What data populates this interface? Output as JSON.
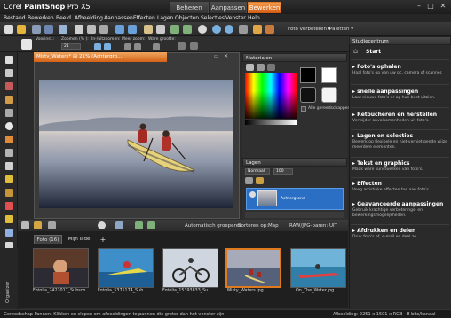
{
  "app": {
    "title_prefix": "Corel",
    "title_main": "PaintShop",
    "title_suffix": " Pro X5",
    "mode_tabs": [
      "Beheren",
      "Aanpassen",
      "Bewerken"
    ],
    "active_mode": "Bewerken",
    "window_buttons": [
      "–",
      "□",
      "✕"
    ]
  },
  "menu": [
    "Bestand",
    "Bewerken",
    "Beeld",
    "Afbeelding",
    "Aanpassen",
    "Effecten",
    "Lagen",
    "Objecten",
    "Selecties",
    "Venster",
    "Help"
  ],
  "toolbar": {
    "photo_fix": "Foto verbeteren ▾",
    "palettes": "Paletten ▾"
  },
  "options": {
    "labels": [
      "Voorinst.:",
      "Zoomen (% ):",
      "In-/uitzoomen:",
      "Meer zoom:",
      "Ware grootte:"
    ],
    "zoom_value": "21"
  },
  "image_window": {
    "tab_title": "Misty_Waters* @ 21% (Achtergro..."
  },
  "materials": {
    "title": "Materialen",
    "all_tools_label": "Alle gereedschappen"
  },
  "layers": {
    "title": "Lagen",
    "blend_mode": "Normaal",
    "opacity": "100",
    "layer_name": "Achtergrond"
  },
  "learning_center": {
    "title": "Studiecentrum",
    "start": "Start",
    "items": [
      {
        "title": "Foto's ophalen",
        "desc": "Haal foto's op van uw pc, camera of scanner."
      },
      {
        "title": "snelle aanpassingen",
        "desc": "Laat nieuwe foto's er op hun best uitzien."
      },
      {
        "title": "Retoucheren en herstellen",
        "desc": "Verwijder onvolkomenheden uit foto's."
      },
      {
        "title": "Lagen en selecties",
        "desc": "Bewerk op flexibele en niet-vernietigende wijze meerdere elementen."
      },
      {
        "title": "Tekst en graphics",
        "desc": "Maak ware kunstwerken van foto's."
      },
      {
        "title": "Effecten",
        "desc": "Voeg artistieke effecten toe aan foto's."
      },
      {
        "title": "Geavanceerde aanpassingen",
        "desc": "Gebruik krachtige verbeterings- en bewerkingsmogelijkheden."
      },
      {
        "title": "Afdrukken en delen",
        "desc": "Druk foto's af, e-mail en deel ze."
      }
    ]
  },
  "organizer": {
    "toolbar_items": [
      "Automatisch groeperen",
      "Sorteren op:",
      "Map",
      "RAW/JPG-paren: UIT"
    ],
    "tabs": [
      "Foto (16)",
      "Mijn lade",
      "+"
    ],
    "side_label": "Organizer",
    "thumbnails": [
      "Fotolia_2422017_Subsco...",
      "Fotolia_5375174_Sub...",
      "Fotolia_15393833_Su...",
      "Misty_Waters.jpg",
      "On_The_Water.jpg"
    ]
  },
  "status": {
    "left": "Gereedschap Pannen: Klikken en slepen om afbeeldingen te pannen die groter dan het venster zijn.",
    "right": "Afbeelding: 2251 x 1501 x RGB - 8 bits/kanaal"
  },
  "colors": {
    "accent": "#e0701e",
    "layer_highlight": "#2a6fc4",
    "background": "#2b2b2b"
  }
}
